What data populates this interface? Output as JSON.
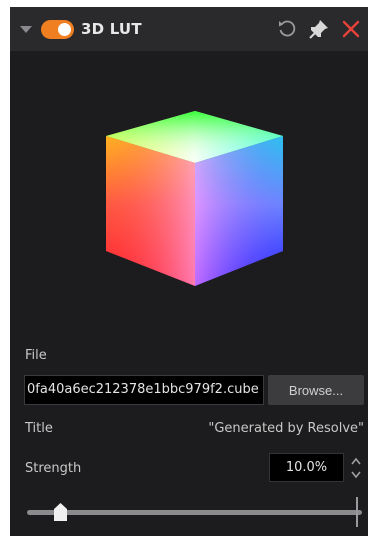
{
  "panel": {
    "title": "3D LUT",
    "enabled": true,
    "accent_color": "#f07f21",
    "close_color": "#e8413a",
    "icons": [
      "chevron-down-icon",
      "reset-icon",
      "pin-icon",
      "close-icon"
    ]
  },
  "file": {
    "label": "File",
    "value": "0fa40a6ec212378e1bbc979f2.cube",
    "browse_label": "Browse..."
  },
  "title_row": {
    "label": "Title",
    "value": "\"Generated by Resolve\""
  },
  "strength": {
    "label": "Strength",
    "value": "10.0%",
    "slider_fraction": 0.1
  }
}
